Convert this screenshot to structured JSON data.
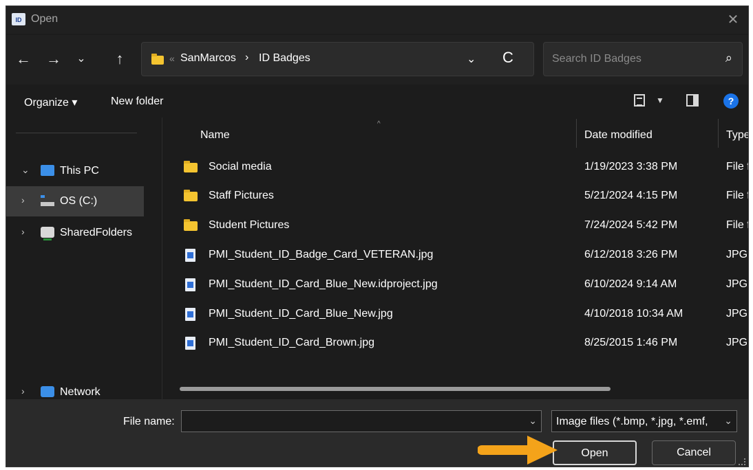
{
  "window": {
    "title": "Open",
    "app_icon": "trust-id-icon",
    "close_glyph": "✕"
  },
  "nav_buttons": {
    "back": "←",
    "forward": "→",
    "recent": "⌄",
    "up": "↑"
  },
  "address_bar": {
    "collapse_glyph": "«",
    "crumbs": [
      "SanMarcos",
      "ID Badges"
    ],
    "separator": "›",
    "dropdown_glyph": "⌄",
    "refresh_glyph": "C"
  },
  "search": {
    "placeholder": "Search ID Badges",
    "icon_glyph": "⌕"
  },
  "command_bar": {
    "organize": "Organize ▾",
    "new_folder": "New folder",
    "help_glyph": "?"
  },
  "nav_pane": {
    "items": [
      {
        "label": "This PC",
        "chevron": "⌄",
        "icon": "monitor-icon"
      },
      {
        "label": "OS (C:)",
        "chevron": "›",
        "icon": "drive-icon",
        "selected": true
      },
      {
        "label": "SharedFolders",
        "chevron": "›",
        "icon": "shared-folder-icon"
      },
      {
        "label": "Network",
        "chevron": "›",
        "icon": "network-icon"
      }
    ]
  },
  "file_list": {
    "columns": [
      "Name",
      "Date modified",
      "Type"
    ],
    "sort_glyph": "^",
    "rows": [
      {
        "name": "Social media",
        "date": "1/19/2023 3:38 PM",
        "type": "File fo",
        "kind": "folder"
      },
      {
        "name": "Staff Pictures",
        "date": "5/21/2024 4:15 PM",
        "type": "File fo",
        "kind": "folder"
      },
      {
        "name": "Student Pictures",
        "date": "7/24/2024 5:42 PM",
        "type": "File fo",
        "kind": "folder"
      },
      {
        "name": "PMI_Student_ID_Badge_Card_VETERAN.jpg",
        "date": "6/12/2018 3:26 PM",
        "type": "JPG Fil",
        "kind": "image"
      },
      {
        "name": "PMI_Student_ID_Card_Blue_New.idproject.jpg",
        "date": "6/10/2024 9:14 AM",
        "type": "JPG Fil",
        "kind": "image"
      },
      {
        "name": "PMI_Student_ID_Card_Blue_New.jpg",
        "date": "4/10/2018 10:34 AM",
        "type": "JPG Fil",
        "kind": "image"
      },
      {
        "name": "PMI_Student_ID_Card_Brown.jpg",
        "date": "8/25/2015 1:46 PM",
        "type": "JPG Fil",
        "kind": "image"
      }
    ]
  },
  "footer": {
    "file_name_label": "File name:",
    "file_name_value": "",
    "file_type": "Image files (*.bmp, *.jpg, *.emf, ",
    "dropdown_glyph": "⌄",
    "open_button": "Open",
    "cancel_button": "Cancel"
  },
  "colors": {
    "dialog_bg": "#1c1c1c",
    "footer_bg": "#2a2a2a",
    "accent_arrow": "#f4a31a",
    "folder": "#f4c430",
    "help": "#1a73e8"
  }
}
